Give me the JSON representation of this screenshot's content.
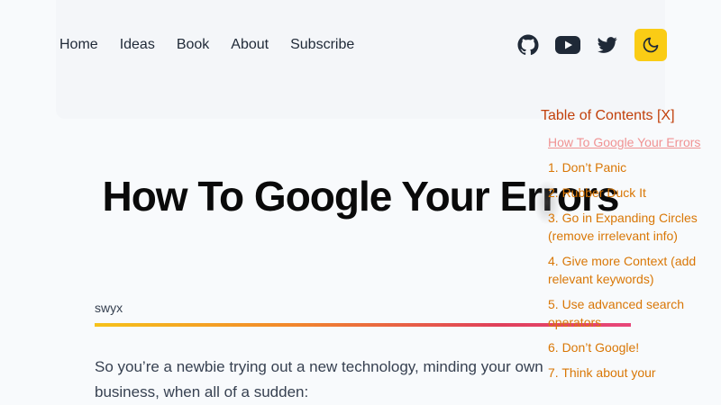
{
  "nav": {
    "items": [
      "Home",
      "Ideas",
      "Book",
      "About",
      "Subscribe"
    ]
  },
  "social": {
    "icons": [
      "github-icon",
      "youtube-icon",
      "twitter-icon"
    ],
    "theme_icon": "moon-icon"
  },
  "colors": {
    "accent": "#facc15",
    "toc_heading": "#c2410c",
    "toc_link": "#d97706",
    "toc_active": "#f09393"
  },
  "article": {
    "title": "How To Google Your Errors",
    "author": "swyx",
    "intro": "So you’re a newbie trying out a new technology, minding your own business, when all of a sudden:"
  },
  "toc": {
    "heading": "Table of Contents [X]",
    "items": [
      "How To Google Your Errors",
      "1. Don’t Panic",
      "2. Rubber Duck It",
      "3. Go in Expanding Circles (remove irrelevant info)",
      "4. Give more Context (add relevant keywords)",
      "5. Use advanced search operators",
      "6. Don’t Google!",
      "7. Think about your"
    ]
  }
}
